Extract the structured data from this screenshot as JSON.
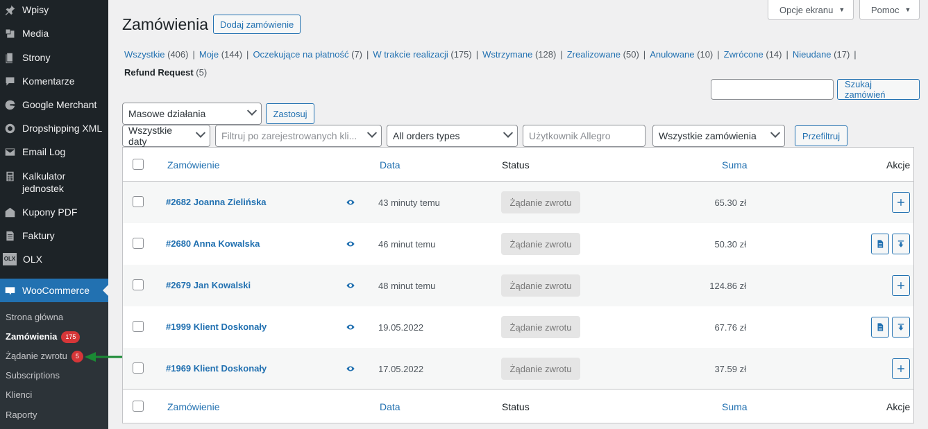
{
  "sidebar": {
    "items": [
      {
        "label": "Wpisy",
        "icon": "pin-icon"
      },
      {
        "label": "Media",
        "icon": "media-icon"
      },
      {
        "label": "Strony",
        "icon": "pages-icon"
      },
      {
        "label": "Komentarze",
        "icon": "comments-icon"
      },
      {
        "label": "Google Merchant",
        "icon": "google-icon"
      },
      {
        "label": "Dropshipping XML",
        "icon": "dropshipping-icon"
      },
      {
        "label": "Email Log",
        "icon": "email-icon"
      },
      {
        "label": "Kalkulator jednostek",
        "icon": "calculator-icon"
      },
      {
        "label": "Kupony PDF",
        "icon": "coupon-icon"
      },
      {
        "label": "Faktury",
        "icon": "invoice-icon"
      },
      {
        "label": "OLX",
        "icon": "olx-icon"
      },
      {
        "label": "WooCommerce",
        "icon": "woocommerce-icon"
      }
    ],
    "submenu": [
      {
        "label": "Strona główna"
      },
      {
        "label": "Zamówienia",
        "badge": "175"
      },
      {
        "label": "Żądanie zwrotu",
        "badge": "5"
      },
      {
        "label": "Subscriptions"
      },
      {
        "label": "Klienci"
      },
      {
        "label": "Raporty"
      }
    ]
  },
  "header": {
    "screen_options": "Opcje ekranu",
    "help": "Pomoc",
    "title": "Zamówienia",
    "add_order": "Dodaj zamówienie"
  },
  "filters_status": [
    {
      "label": "Wszystkie",
      "count": "(406)"
    },
    {
      "label": "Moje",
      "count": "(144)"
    },
    {
      "label": "Oczekujące na płatność",
      "count": "(7)"
    },
    {
      "label": "W trakcie realizacji",
      "count": "(175)"
    },
    {
      "label": "Wstrzymane",
      "count": "(128)"
    },
    {
      "label": "Zrealizowane",
      "count": "(50)"
    },
    {
      "label": "Anulowane",
      "count": "(10)"
    },
    {
      "label": "Zwrócone",
      "count": "(14)"
    },
    {
      "label": "Nieudane",
      "count": "(17)"
    },
    {
      "label": "Refund Request",
      "count": "(5)"
    }
  ],
  "search": {
    "value": "",
    "button": "Szukaj zamówień"
  },
  "bulk": {
    "selected": "Masowe działania",
    "apply": "Zastosuj"
  },
  "filters": {
    "dates": "Wszystkie daty",
    "customer_placeholder": "Filtruj po zarejestrowanych kli...",
    "order_types": "All orders types",
    "allegro_user": "Użytkownik Allegro",
    "all_orders": "Wszystkie zamówienia",
    "filter_button": "Przefiltruj"
  },
  "table": {
    "columns": {
      "order": "Zamówienie",
      "date": "Data",
      "status": "Status",
      "total": "Suma",
      "actions": "Akcje"
    },
    "rows": [
      {
        "order": "#2682 Joanna Zielińska",
        "date": "43 minuty temu",
        "status": "Żądanie zwrotu",
        "total": "65.30 zł",
        "actions": [
          "plus-icon"
        ]
      },
      {
        "order": "#2680 Anna Kowalska",
        "date": "46 minut temu",
        "status": "Żądanie zwrotu",
        "total": "50.30 zł",
        "actions": [
          "invoice-icon",
          "download-icon"
        ]
      },
      {
        "order": "#2679 Jan Kowalski",
        "date": "48 minut temu",
        "status": "Żądanie zwrotu",
        "total": "124.86 zł",
        "actions": [
          "plus-icon"
        ]
      },
      {
        "order": "#1999 Klient Doskonały",
        "date": "19.05.2022",
        "status": "Żądanie zwrotu",
        "total": "67.76 zł",
        "actions": [
          "invoice-icon",
          "download-icon"
        ]
      },
      {
        "order": "#1969 Klient Doskonały",
        "date": "17.05.2022",
        "status": "Żądanie zwrotu",
        "total": "37.59 zł",
        "actions": [
          "plus-icon"
        ]
      }
    ]
  },
  "colors": {
    "accent": "#2271b1",
    "sidebar_bg": "#1d2327",
    "badge": "#d63638",
    "arrow": "#1a8a34"
  }
}
